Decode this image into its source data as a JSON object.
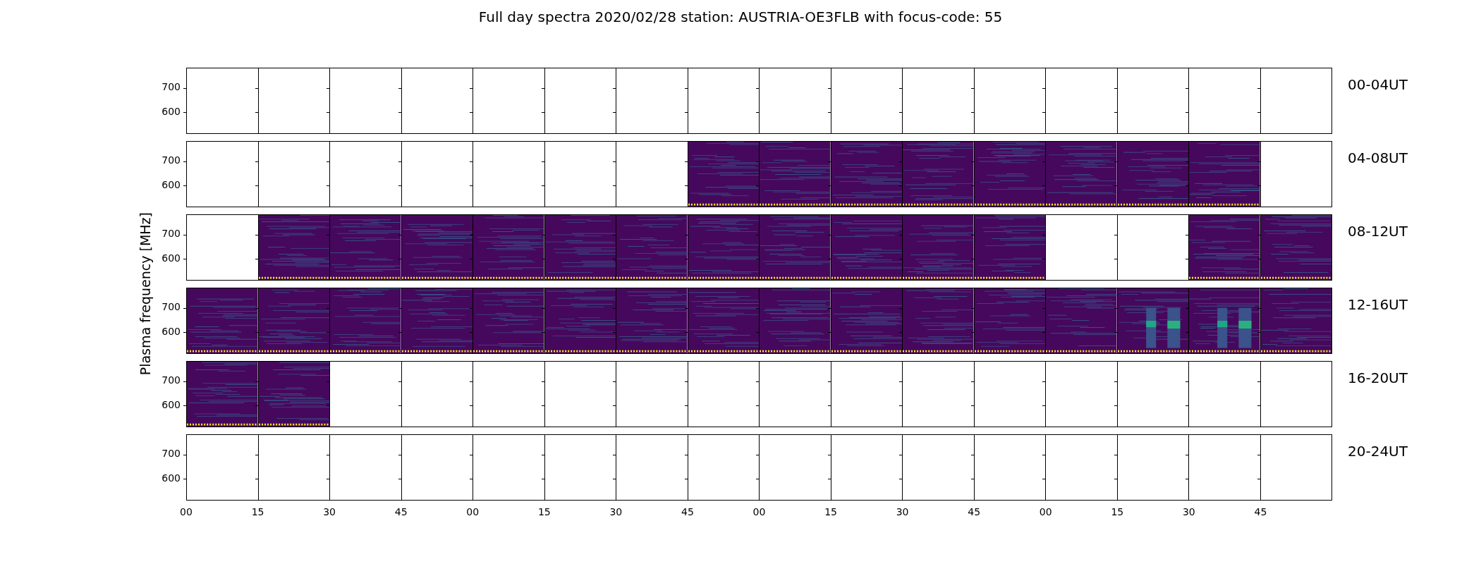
{
  "title": "Full day spectra 2020/02/28 station: AUSTRIA-OE3FLB with focus-code: 55",
  "ylabel": "Plasma frequency [MHz]",
  "panels": [
    {
      "label": "00-04UT",
      "y_ticks": [
        "700",
        "600"
      ],
      "cells": [
        {
          "has_data": false
        },
        {
          "has_data": false
        },
        {
          "has_data": false
        },
        {
          "has_data": false
        },
        {
          "has_data": false
        },
        {
          "has_data": false
        },
        {
          "has_data": false
        },
        {
          "has_data": false
        },
        {
          "has_data": false
        },
        {
          "has_data": false
        },
        {
          "has_data": false
        },
        {
          "has_data": false
        },
        {
          "has_data": false
        },
        {
          "has_data": false
        },
        {
          "has_data": false
        },
        {
          "has_data": false
        }
      ]
    },
    {
      "label": "04-08UT",
      "y_ticks": [
        "700",
        "600"
      ],
      "cells": [
        {
          "has_data": false
        },
        {
          "has_data": false
        },
        {
          "has_data": false
        },
        {
          "has_data": false
        },
        {
          "has_data": false
        },
        {
          "has_data": false
        },
        {
          "has_data": false
        },
        {
          "has_data": true
        },
        {
          "has_data": true
        },
        {
          "has_data": true
        },
        {
          "has_data": true
        },
        {
          "has_data": true
        },
        {
          "has_data": true
        },
        {
          "has_data": true
        },
        {
          "has_data": true
        },
        {
          "has_data": false
        }
      ]
    },
    {
      "label": "08-12UT",
      "y_ticks": [
        "700",
        "600"
      ],
      "cells": [
        {
          "has_data": false
        },
        {
          "has_data": true
        },
        {
          "has_data": true
        },
        {
          "has_data": true
        },
        {
          "has_data": true
        },
        {
          "has_data": true
        },
        {
          "has_data": true
        },
        {
          "has_data": true
        },
        {
          "has_data": true
        },
        {
          "has_data": true
        },
        {
          "has_data": true
        },
        {
          "has_data": true
        },
        {
          "has_data": false
        },
        {
          "has_data": false
        },
        {
          "has_data": true
        },
        {
          "has_data": true
        }
      ]
    },
    {
      "label": "12-16UT",
      "y_ticks": [
        "700",
        "600"
      ],
      "cells": [
        {
          "has_data": true
        },
        {
          "has_data": true
        },
        {
          "has_data": true
        },
        {
          "has_data": true
        },
        {
          "has_data": true
        },
        {
          "has_data": true
        },
        {
          "has_data": true
        },
        {
          "has_data": true
        },
        {
          "has_data": true
        },
        {
          "has_data": true
        },
        {
          "has_data": true
        },
        {
          "has_data": true
        },
        {
          "has_data": true
        },
        {
          "has_data": true,
          "bursts": true
        },
        {
          "has_data": true,
          "bursts": true
        },
        {
          "has_data": true
        }
      ]
    },
    {
      "label": "16-20UT",
      "y_ticks": [
        "700",
        "600"
      ],
      "cells": [
        {
          "has_data": true
        },
        {
          "has_data": true
        },
        {
          "has_data": false
        },
        {
          "has_data": false
        },
        {
          "has_data": false
        },
        {
          "has_data": false
        },
        {
          "has_data": false
        },
        {
          "has_data": false
        },
        {
          "has_data": false
        },
        {
          "has_data": false
        },
        {
          "has_data": false
        },
        {
          "has_data": false
        },
        {
          "has_data": false
        },
        {
          "has_data": false
        },
        {
          "has_data": false
        },
        {
          "has_data": false
        }
      ]
    },
    {
      "label": "20-24UT",
      "y_ticks": [
        "700",
        "600"
      ],
      "cells": [
        {
          "has_data": false
        },
        {
          "has_data": false
        },
        {
          "has_data": false
        },
        {
          "has_data": false
        },
        {
          "has_data": false
        },
        {
          "has_data": false
        },
        {
          "has_data": false
        },
        {
          "has_data": false
        },
        {
          "has_data": false
        },
        {
          "has_data": false
        },
        {
          "has_data": false
        },
        {
          "has_data": false
        },
        {
          "has_data": false
        },
        {
          "has_data": false
        },
        {
          "has_data": false
        },
        {
          "has_data": false
        }
      ]
    }
  ],
  "x_ticks": [
    "00",
    "15",
    "30",
    "45",
    "00",
    "15",
    "30",
    "45",
    "00",
    "15",
    "30",
    "45",
    "00",
    "15",
    "30",
    "45"
  ]
}
